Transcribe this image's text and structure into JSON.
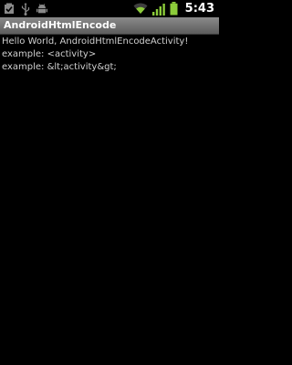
{
  "status_bar": {
    "time": "5:43",
    "icons_left": [
      "screenshot-check-icon",
      "usb-icon",
      "android-debug-icon"
    ],
    "icons_right": [
      "wifi-icon",
      "signal-icon",
      "battery-icon"
    ]
  },
  "app_bar": {
    "title": "AndroidHtmlEncode"
  },
  "content": {
    "lines": [
      "Hello World, AndroidHtmlEncodeActivity!",
      "example: <activity>",
      "example: &lt;activity&gt;"
    ]
  },
  "colors": {
    "background": "#000000",
    "title_bar": "#6e6e6e",
    "text": "#d0d0d0",
    "signal_green": "#8ccc3a"
  }
}
